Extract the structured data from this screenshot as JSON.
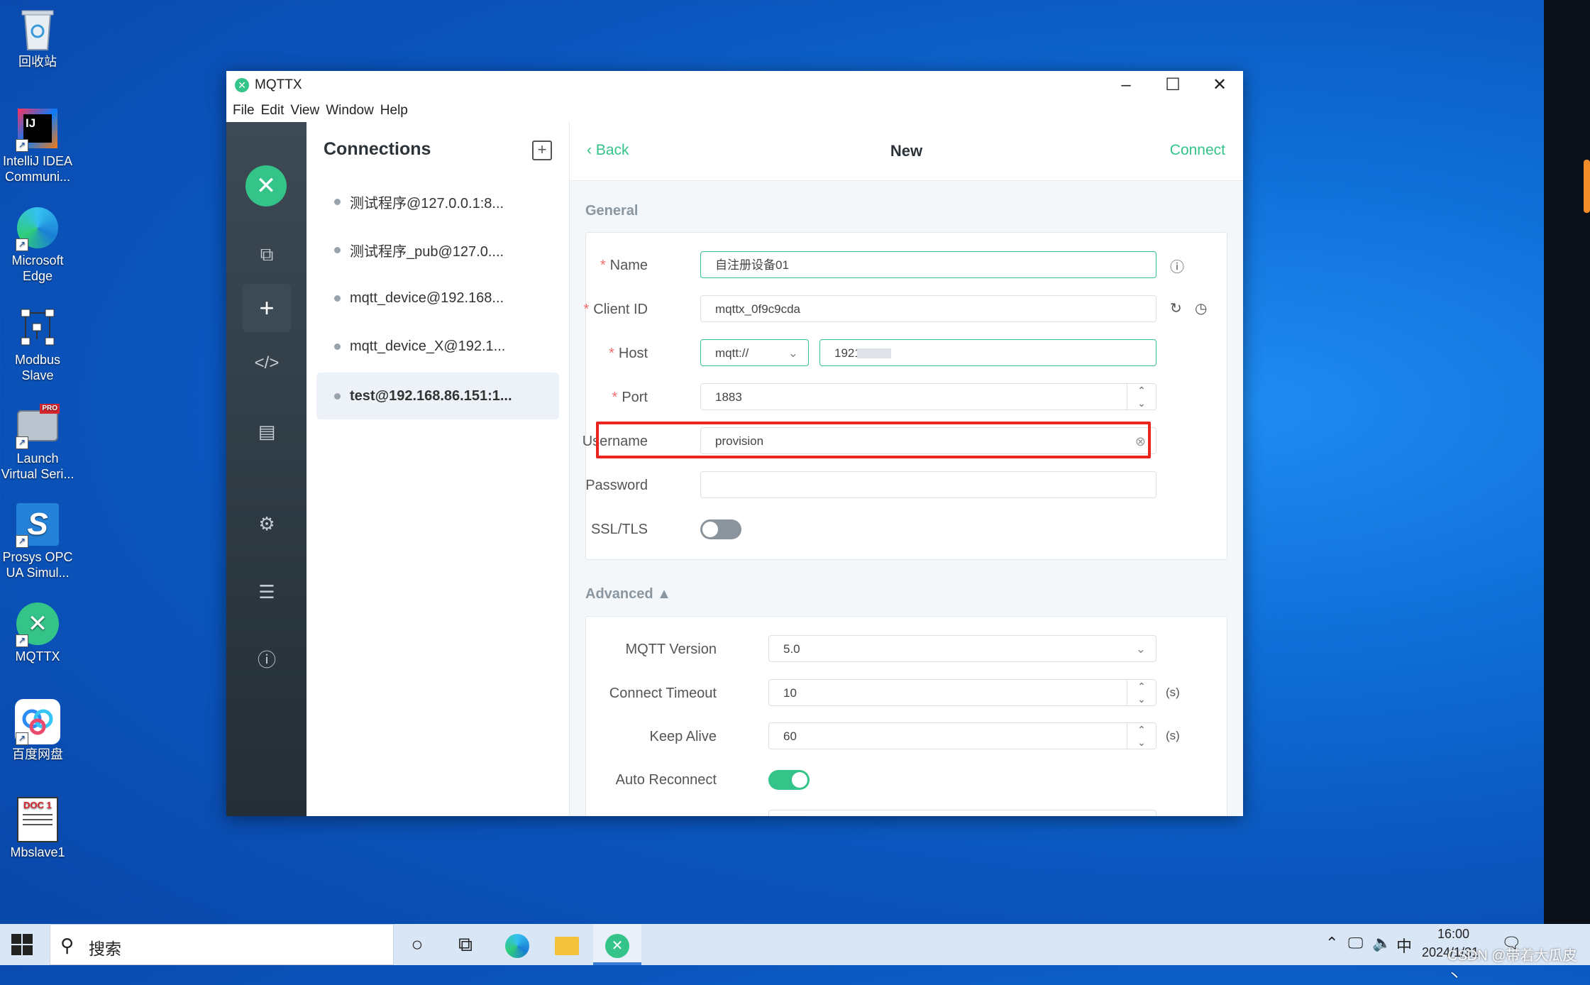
{
  "desktop": {
    "icons": [
      {
        "label": "回收站",
        "icon": "recycle-bin-icon"
      },
      {
        "label": "IntelliJ IDEA Communi...",
        "icon": "intellij-icon"
      },
      {
        "label": "Microsoft Edge",
        "icon": "edge-icon"
      },
      {
        "label": "Modbus Slave",
        "icon": "modbus-icon"
      },
      {
        "label": "Launch Virtual Seri...",
        "icon": "virtual-serial-icon"
      },
      {
        "label": "Prosys OPC UA Simul...",
        "icon": "prosys-icon"
      },
      {
        "label": "MQTTX",
        "icon": "mqttx-icon"
      },
      {
        "label": "百度网盘",
        "icon": "baidu-netdisk-icon"
      },
      {
        "label": "Mbslave1",
        "icon": "document-icon"
      }
    ],
    "intellij_badge": "IJ",
    "prosys_badge": "S",
    "pro_badge": "PRO",
    "doc_badge": "DOC 1"
  },
  "window": {
    "title": "MQTTX",
    "menu": [
      "File",
      "Edit",
      "View",
      "Window",
      "Help"
    ]
  },
  "connections": {
    "heading": "Connections",
    "items": [
      "测试程序@127.0.0.1:8...",
      "测试程序_pub@127.0....",
      "mqtt_device@192.168...",
      "mqtt_device_X@192.1...",
      "test@192.168.86.151:1..."
    ],
    "selected_index": 4
  },
  "editor": {
    "back_label": "Back",
    "title": "New",
    "connect_label": "Connect",
    "general_label": "General",
    "advanced_label": "Advanced ▲",
    "fields": {
      "name": {
        "label": "Name",
        "value": "自注册设备01"
      },
      "client_id": {
        "label": "Client ID",
        "value": "mqttx_0f9c9cda"
      },
      "host": {
        "label": "Host",
        "protocol": "mqtt://",
        "value": "1921   151"
      },
      "port": {
        "label": "Port",
        "value": "1883"
      },
      "username": {
        "label": "Username",
        "value": "provision"
      },
      "password": {
        "label": "Password",
        "value": ""
      },
      "ssl": {
        "label": "SSL/TLS",
        "enabled": false
      }
    },
    "advanced": {
      "mqtt_version": {
        "label": "MQTT Version",
        "value": "5.0"
      },
      "connect_timeout": {
        "label": "Connect Timeout",
        "value": "10",
        "unit": "(s)"
      },
      "keep_alive": {
        "label": "Keep Alive",
        "value": "60",
        "unit": "(s)"
      },
      "auto_reconnect": {
        "label": "Auto Reconnect",
        "enabled": true
      }
    },
    "required_mark": "*"
  },
  "taskbar": {
    "search_placeholder": "搜索",
    "ime": "中",
    "time": "16:00",
    "date": "2024/1/31",
    "watermark": "CSDN @带着大瓜皮丶"
  },
  "colors": {
    "accent": "#34c388",
    "highlight": "#e8251f"
  }
}
